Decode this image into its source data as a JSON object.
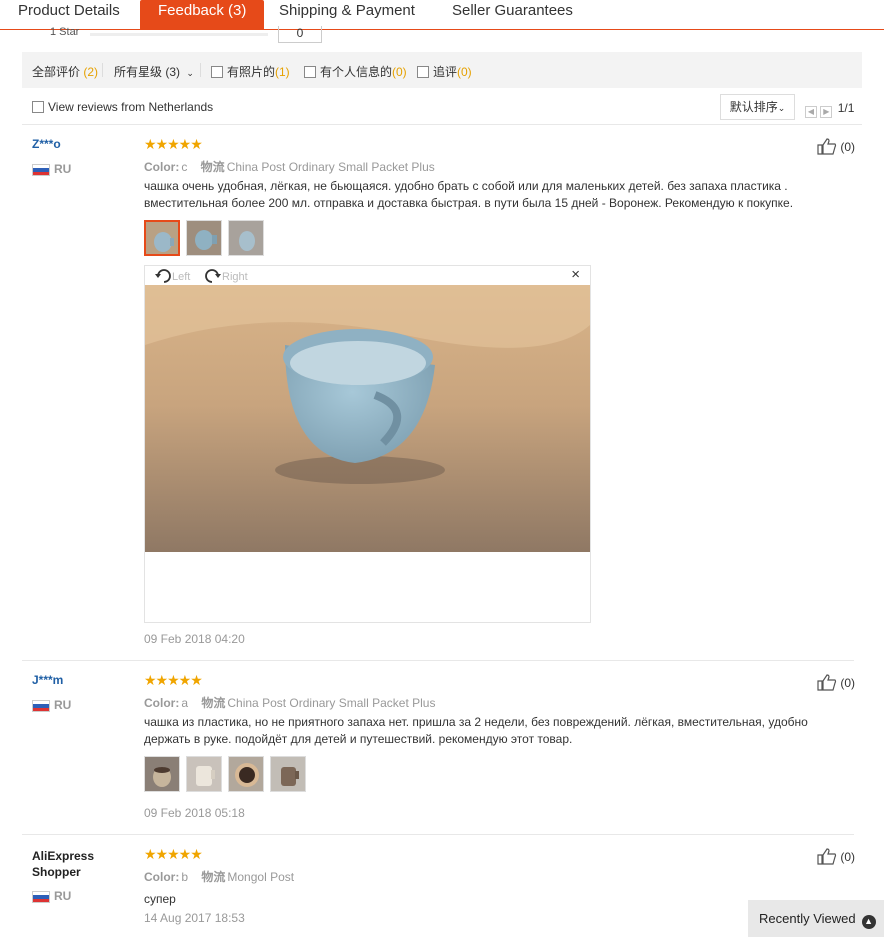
{
  "tabs": [
    {
      "label": "Product Details"
    },
    {
      "label": "Feedback (3)"
    },
    {
      "label": "Shipping & Payment"
    },
    {
      "label": "Seller Guarantees"
    }
  ],
  "rating_row": {
    "label": "1 Star",
    "count": "0"
  },
  "filters": {
    "all_label": "全部评价",
    "all_count": "(2)",
    "stars_label": "所有星级 (3)",
    "photos_label": "有照片的",
    "photos_count": "(1)",
    "personal_label": "有个人信息的",
    "personal_count": "(0)",
    "followup_label": "追评",
    "followup_count": "(0)"
  },
  "country_filter": {
    "label": "View reviews from Netherlands"
  },
  "sort": {
    "label": "默认排序"
  },
  "pager": {
    "label": "1/1"
  },
  "reviews": [
    {
      "user": "Z***o",
      "country": "RU",
      "stars": "★★★★★",
      "color_label": "Color:",
      "color": "c",
      "shipping_label": "物流",
      "shipping": "China Post Ordinary Small Packet Plus",
      "text": "чашка очень удобная, лёгкая, не бьющаяся. удобно брать с собой или для маленьких детей. без запаха пластика . вместительная более 200 мл. отправка и доставка быстрая. в пути была 15 дней - Воронеж. Рекомендую к покупке.",
      "date": "09 Feb 2018 04:20",
      "likes": "(0)"
    },
    {
      "user": "J***m",
      "country": "RU",
      "stars": "★★★★★",
      "color_label": "Color:",
      "color": "a",
      "shipping_label": "物流",
      "shipping": "China Post Ordinary Small Packet Plus",
      "text": "чашка из пластика, но не приятного запаха нет. пришла за 2 недели, без повреждений. лёгкая, вместительная, удобно держать в руке. подойдёт для детей и путешествий. рекомендую этот товар.",
      "date": "09 Feb 2018 05:18",
      "likes": "(0)"
    },
    {
      "user": "AliExpress Shopper",
      "country": "RU",
      "stars": "★★★★★",
      "color_label": "Color:",
      "color": "b",
      "shipping_label": "物流",
      "shipping": "Mongol Post",
      "text": "супер",
      "date": "14 Aug 2017 18:53",
      "likes": "(0)"
    }
  ],
  "viewer": {
    "left_label": "Left",
    "right_label": "Right",
    "close": "×"
  },
  "recently_viewed": {
    "label": "Recently Viewed"
  }
}
